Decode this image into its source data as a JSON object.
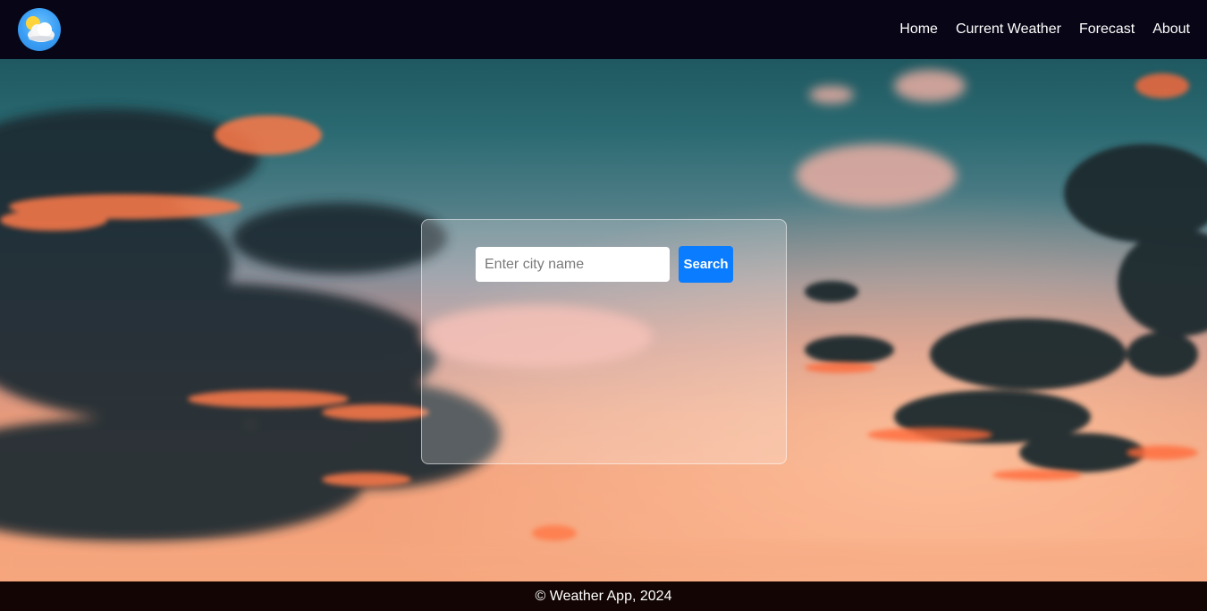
{
  "app": {
    "logo_icon": "sun-behind-cloud-icon"
  },
  "nav": {
    "items": [
      {
        "label": "Home"
      },
      {
        "label": "Current Weather"
      },
      {
        "label": "Forecast"
      },
      {
        "label": "About"
      }
    ]
  },
  "search": {
    "placeholder": "Enter city name",
    "value": "",
    "button_label": "Search"
  },
  "footer": {
    "text": "© Weather App, 2024"
  },
  "colors": {
    "header_bg": "#080616",
    "footer_bg": "#120503",
    "button_bg": "#0a7cff",
    "sky_top": "#1f5860",
    "sky_bottom": "#f6a57c"
  }
}
